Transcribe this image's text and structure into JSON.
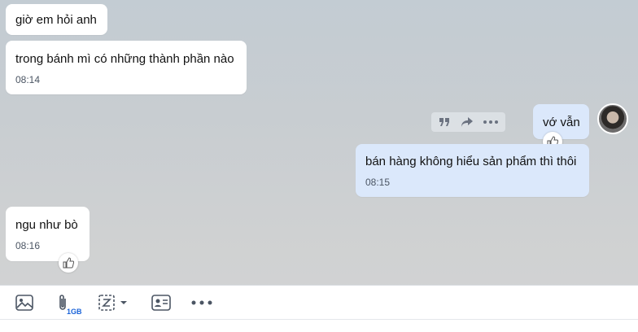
{
  "messages": [
    {
      "id": "m1",
      "side": "in",
      "text": "giờ em hỏi anh",
      "time": ""
    },
    {
      "id": "m2",
      "side": "in",
      "text": "trong bánh mì có những thành phần nào",
      "time": "08:14"
    },
    {
      "id": "m3",
      "side": "out",
      "text": "vớ vẫn",
      "time": ""
    },
    {
      "id": "m4",
      "side": "out",
      "text": "bán hàng không hiểu sản phẩm thì thôi",
      "time": "08:15"
    },
    {
      "id": "m5",
      "side": "in",
      "text": "ngu như bò",
      "time": "08:16"
    }
  ],
  "hover_actions": [
    "quote-icon",
    "forward-icon",
    "more-icon"
  ],
  "reaction_icon": "thumbs-up-icon",
  "toolbar": {
    "items": [
      "image-icon",
      "attach-icon",
      "screenshot-icon",
      "contact-card-icon",
      "more-options-icon"
    ],
    "attach_badge": "1GB"
  },
  "colors": {
    "incoming": "#ffffff",
    "outgoing": "#dbe8fb",
    "accent": "#1a63d8"
  }
}
